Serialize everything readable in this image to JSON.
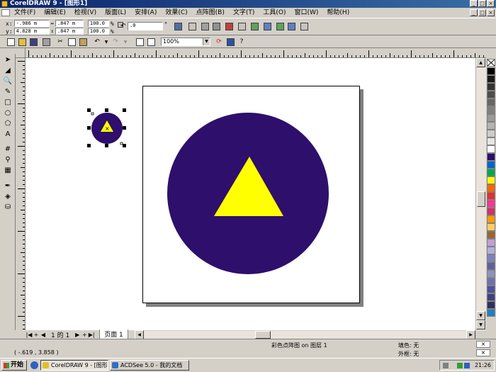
{
  "window": {
    "title": "CorelDRAW 9 - [图形1]"
  },
  "menu": [
    "文件(F)",
    "编辑(E)",
    "检视(V)",
    "版面(L)",
    "安排(A)",
    "效果(C)",
    "点阵图(B)",
    "文字(T)",
    "工具(O)",
    "窗口(W)",
    "帮助(H)"
  ],
  "propbar": {
    "x_label": "x:",
    "x_value": "-.986 m",
    "y_label": "y:",
    "y_value": "4.828 m",
    "w_value": ".847 m",
    "h_value": ".847 m",
    "scale_x": "100.0",
    "scale_y": "100.0",
    "percent": "%",
    "rotation": ".0",
    "degree": "°"
  },
  "stdbar": {
    "zoom": "100%"
  },
  "pagebar": {
    "counter": "1 的 1",
    "page_tab": "页面 1"
  },
  "status": {
    "coords": "( -.619 , 3.858 )",
    "object_info": "彩色点阵图 on 图层 1",
    "fill_label": "填色:",
    "fill_value": "无",
    "outline_label": "外框:",
    "outline_value": "无"
  },
  "taskbar": {
    "start": "开始",
    "tasks": [
      "CorelDRAW 9 - [图形1]",
      "ACDSee 5.0 - 我的文档"
    ],
    "clock": "21:26"
  },
  "palette": [
    "#000000",
    "#1a1a1a",
    "#333333",
    "#4d4d4d",
    "#666666",
    "#808080",
    "#999999",
    "#b3b3b3",
    "#cccccc",
    "#e6e6e6",
    "#ffffff",
    "#2e0f6b",
    "#0066cc",
    "#00a651",
    "#ffff00",
    "#ff6600",
    "#e62e2e",
    "#ff3399",
    "#cc3366",
    "#ff9900",
    "#ffcc66",
    "#996633",
    "#c0a0d0",
    "#b0b0e0",
    "#8080c0",
    "#6060a0",
    "#9090c0",
    "#7070b0",
    "#5050a0",
    "#404080",
    "#303060",
    "#2080c0"
  ],
  "colors": {
    "circle": "#2e0f6b",
    "triangle": "#ffff00"
  }
}
